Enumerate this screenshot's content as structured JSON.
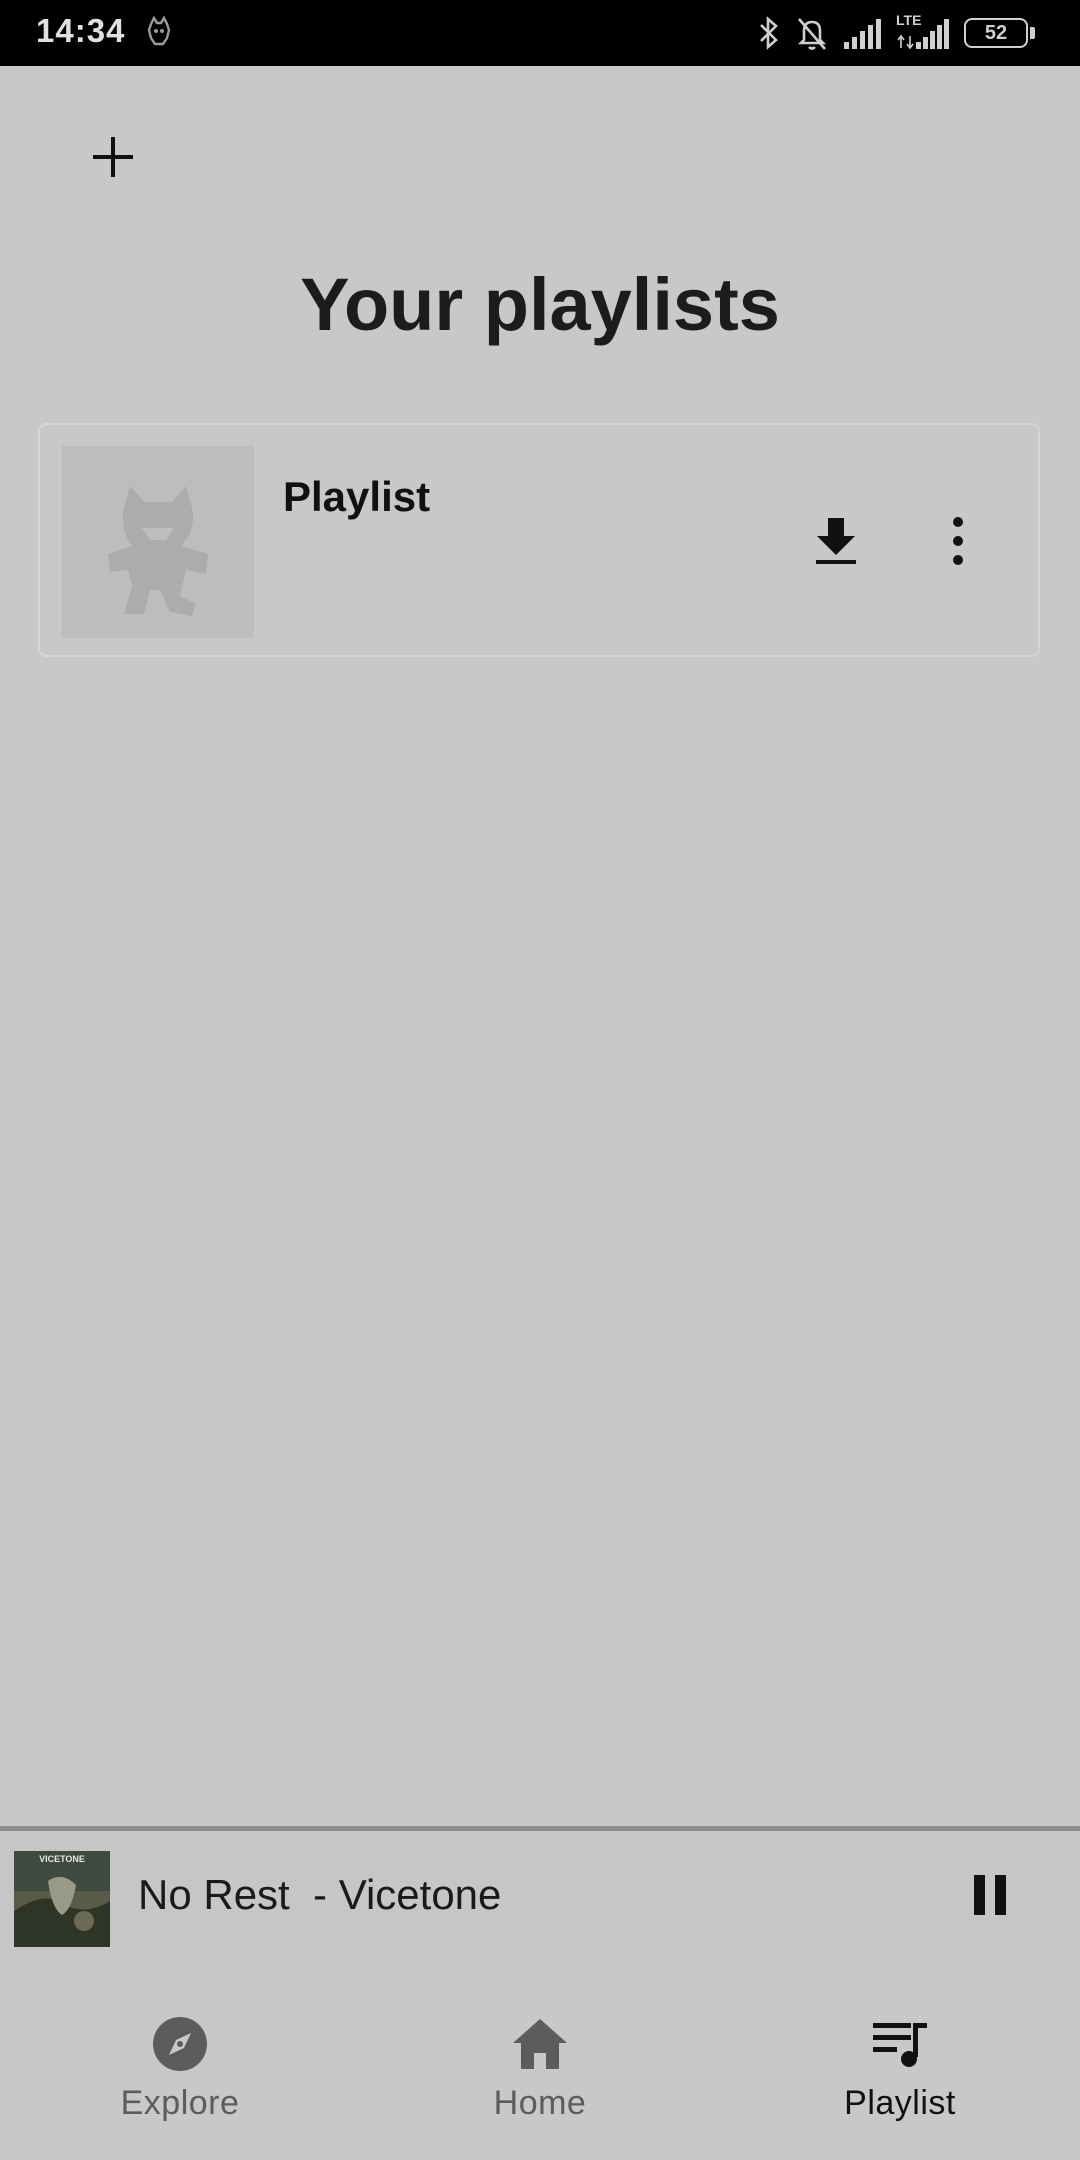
{
  "status_bar": {
    "time": "14:34",
    "network_label": "LTE",
    "battery": "52"
  },
  "header": {
    "title": "Your playlists"
  },
  "playlists": [
    {
      "name": "Playlist"
    }
  ],
  "now_playing": {
    "text": "No Rest  - Vicetone",
    "album_art_text": "VICETONE"
  },
  "nav": {
    "items": [
      {
        "label": "Explore",
        "icon": "compass-icon"
      },
      {
        "label": "Home",
        "icon": "home-icon"
      },
      {
        "label": "Playlist",
        "icon": "playlist-music-icon",
        "active": true
      }
    ]
  }
}
